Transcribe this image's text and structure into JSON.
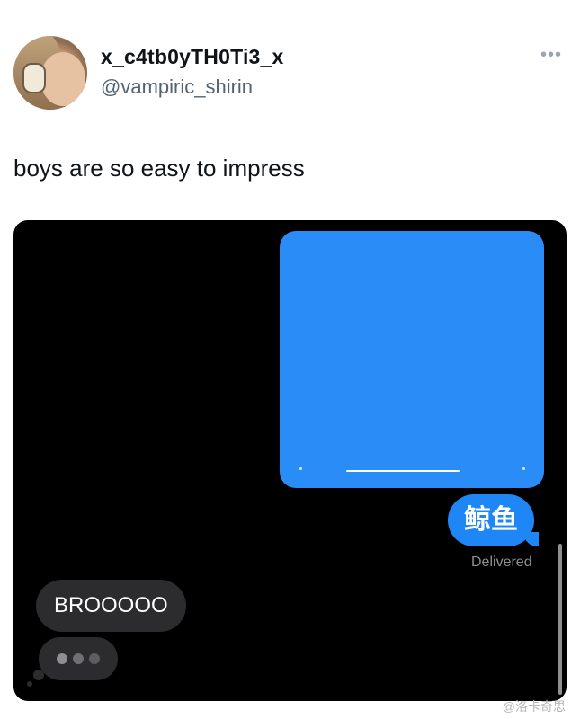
{
  "tweet": {
    "display_name": "x_c4tb0yTH0Ti3_x",
    "handle": "@vampiric_shirin",
    "more_icon": "more-horizontal-icon",
    "text": "boys are so easy to impress"
  },
  "chat": {
    "sent_message": "鲸鱼",
    "sent_status": "Delivered",
    "received_message": "BROOOOO",
    "typing_indicator": "typing-dots-icon",
    "colors": {
      "sent_bubble": "#1e86f5",
      "received_bubble": "#2c2c2e",
      "background": "#000000"
    }
  },
  "watermark": "@洛卡奇思"
}
